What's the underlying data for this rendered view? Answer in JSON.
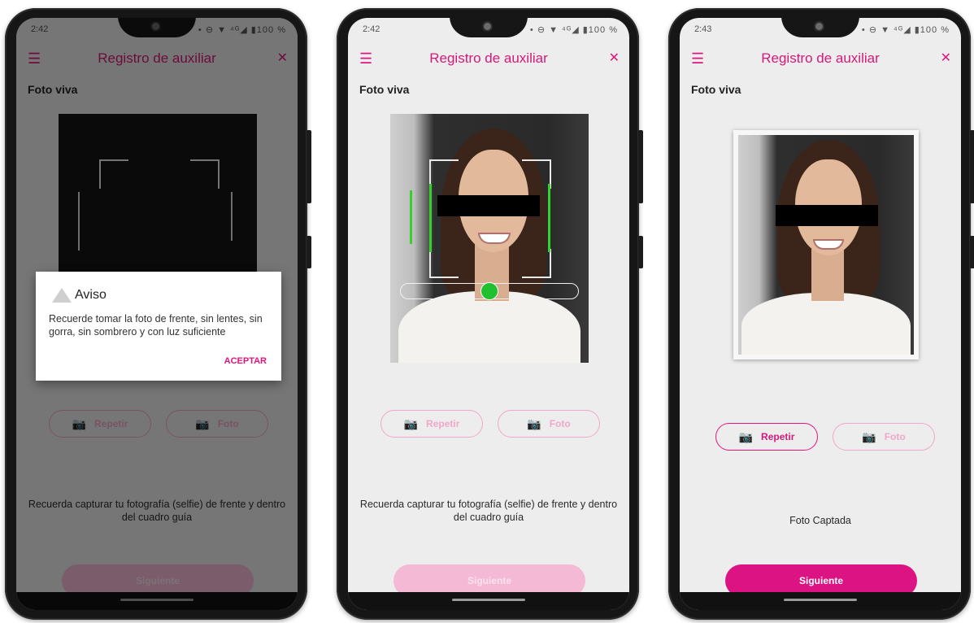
{
  "screens": [
    {
      "status": {
        "time": "2:42",
        "icons": "• ⊖ ▼ ⁴ᴳ◢ ▮100 %"
      },
      "appbar": {
        "title": "Registro de auxiliar",
        "menu_icon": "menu-icon",
        "close_icon": "close-icon"
      },
      "section_title": "Foto viva",
      "buttons": {
        "repeat": "Repetir",
        "photo": "Foto"
      },
      "hint": "Recuerda capturar tu fotografía (selfie) de frente y dentro del cuadro guía",
      "next": "Siguiente",
      "dialog": {
        "title": "Aviso",
        "message": "Recuerde tomar la foto de frente, sin lentes, sin gorra, sin sombrero y con luz suficiente",
        "accept": "ACEPTAR"
      }
    },
    {
      "status": {
        "time": "2:42",
        "icons": "• ⊖ ▼ ⁴ᴳ◢ ▮100 %"
      },
      "appbar": {
        "title": "Registro de auxiliar"
      },
      "section_title": "Foto viva",
      "buttons": {
        "repeat": "Repetir",
        "photo": "Foto"
      },
      "hint": "Recuerda capturar tu fotografía (selfie) de frente y dentro del cuadro guía",
      "next": "Siguiente",
      "guide_slider_level": 0.5
    },
    {
      "status": {
        "time": "2:43",
        "icons": "• ⊖ ▼ ⁴ᴳ◢ ▮100 %"
      },
      "appbar": {
        "title": "Registro de auxiliar"
      },
      "section_title": "Foto viva",
      "buttons": {
        "repeat": "Repetir",
        "photo": "Foto"
      },
      "hint": "Foto Captada",
      "next": "Siguiente"
    }
  ],
  "colors": {
    "accent": "#e0157f",
    "accent_light": "#f4b9d5",
    "guide_dot": "#20c030"
  }
}
